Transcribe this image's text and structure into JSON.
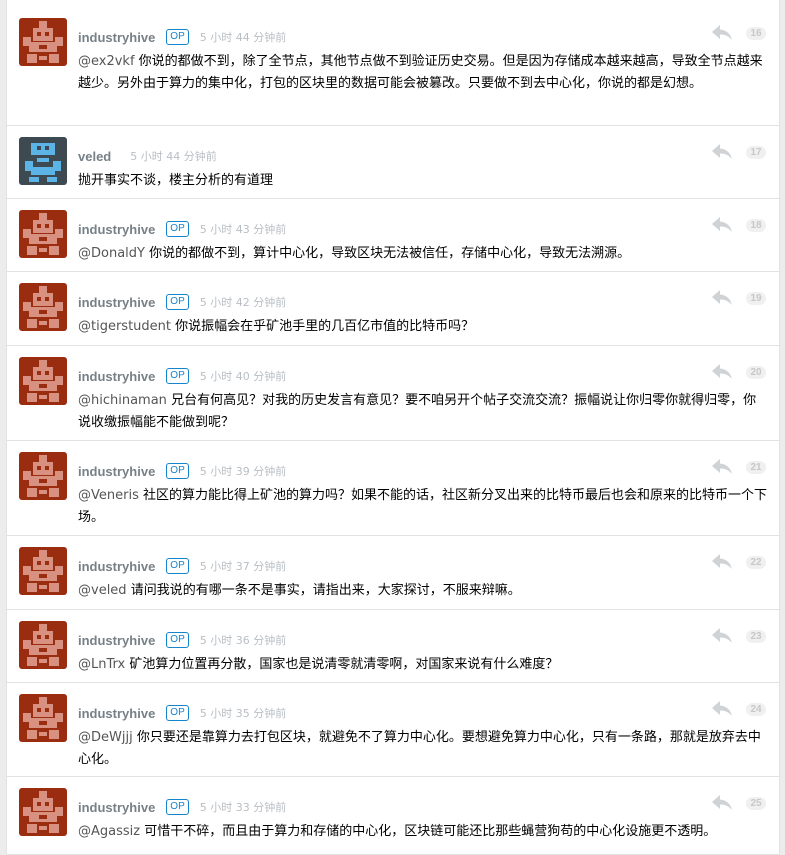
{
  "colors": {
    "accent": "#1484cd",
    "username": "#778087",
    "timestamp": "#b8bec4",
    "industryhive_avatar_bg": "#9a2d10",
    "industryhive_avatar_fg": "#d89080",
    "veled_avatar_bg": "#3e4a52",
    "veled_avatar_fg": "#5bb3e6"
  },
  "replies": [
    {
      "username": "industryhive",
      "op_badge": "OP",
      "time": "5 小时 44 分钟前",
      "floor": "16",
      "mention": "@ex2vkf",
      "text": " 你说的都做不到，除了全节点，其他节点做不到验证历史交易。但是因为存储成本越来越高，导致全节点越来越少。另外由于算力的集中化，打包的区块里的数据可能会被篡改。只要做不到去中心化，你说的都是幻想。",
      "avatar": "industryhive-avatar-icon"
    },
    {
      "username": "veled",
      "op_badge": "",
      "time": "5 小时 44 分钟前",
      "floor": "17",
      "mention": "",
      "text": "抛开事实不谈，楼主分析的有道理",
      "avatar": "veled-avatar-icon"
    },
    {
      "username": "industryhive",
      "op_badge": "OP",
      "time": "5 小时 43 分钟前",
      "floor": "18",
      "mention": "@DonaldY",
      "text": " 你说的都做不到，算计中心化，导致区块无法被信任，存储中心化，导致无法溯源。",
      "avatar": "industryhive-avatar-icon"
    },
    {
      "username": "industryhive",
      "op_badge": "OP",
      "time": "5 小时 42 分钟前",
      "floor": "19",
      "mention": "@tigerstudent",
      "text": " 你说振幅会在乎矿池手里的几百亿市值的比特币吗？",
      "avatar": "industryhive-avatar-icon"
    },
    {
      "username": "industryhive",
      "op_badge": "OP",
      "time": "5 小时 40 分钟前",
      "floor": "20",
      "mention": "@hichinaman",
      "text": " 兄台有何高见？对我的历史发言有意见？要不咱另开个帖子交流交流？振幅说让你归零你就得归零，你说收缴振幅能不能做到呢？",
      "avatar": "industryhive-avatar-icon"
    },
    {
      "username": "industryhive",
      "op_badge": "OP",
      "time": "5 小时 39 分钟前",
      "floor": "21",
      "mention": "@Veneris",
      "text": " 社区的算力能比得上矿池的算力吗？如果不能的话，社区新分叉出来的比特币最后也会和原来的比特币一个下场。",
      "avatar": "industryhive-avatar-icon"
    },
    {
      "username": "industryhive",
      "op_badge": "OP",
      "time": "5 小时 37 分钟前",
      "floor": "22",
      "mention": "@veled",
      "text": " 请问我说的有哪一条不是事实，请指出来，大家探讨，不服来辩嘛。",
      "avatar": "industryhive-avatar-icon"
    },
    {
      "username": "industryhive",
      "op_badge": "OP",
      "time": "5 小时 36 分钟前",
      "floor": "23",
      "mention": "@LnTrx",
      "text": " 矿池算力位置再分散，国家也是说清零就清零啊，对国家来说有什么难度？",
      "avatar": "industryhive-avatar-icon"
    },
    {
      "username": "industryhive",
      "op_badge": "OP",
      "time": "5 小时 35 分钟前",
      "floor": "24",
      "mention": "@DeWjjj",
      "text": " 你只要还是靠算力去打包区块，就避免不了算力中心化。要想避免算力中心化，只有一条路，那就是放弃去中心化。",
      "avatar": "industryhive-avatar-icon"
    },
    {
      "username": "industryhive",
      "op_badge": "OP",
      "time": "5 小时 33 分钟前",
      "floor": "25",
      "mention": "@Agassiz",
      "text": " 可惜干不碎，而且由于算力和存储的中心化，区块链可能还比那些蝇营狗苟的中心化设施更不透明。",
      "avatar": "industryhive-avatar-icon"
    }
  ]
}
